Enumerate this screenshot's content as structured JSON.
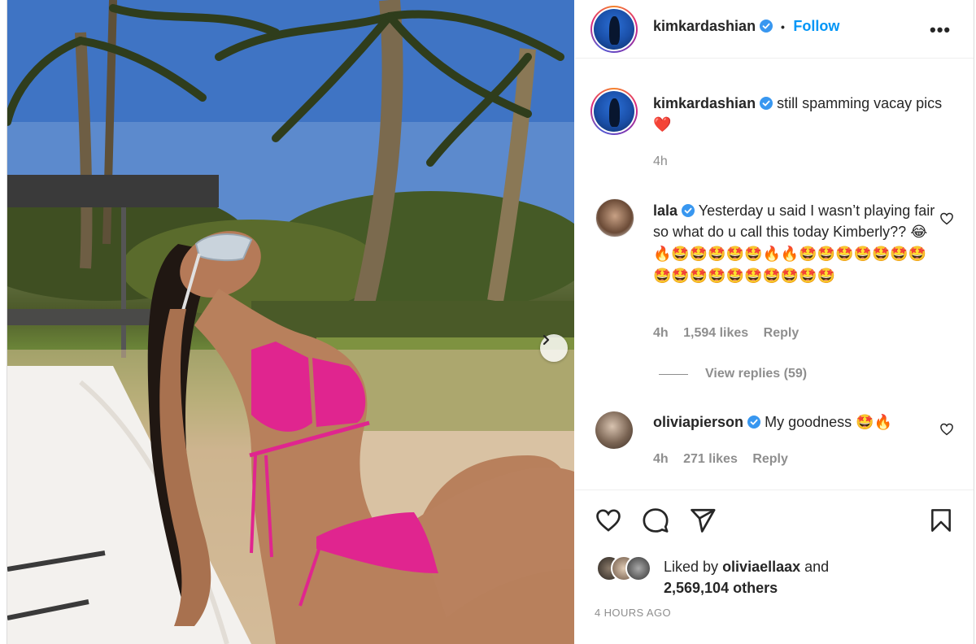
{
  "post": {
    "author": "kimkardashian",
    "follow_label": "Follow",
    "separator": "•",
    "more_label": "•••",
    "caption": "still spamming vacay pics",
    "caption_emoji": "❤️",
    "caption_time": "4h"
  },
  "comments": [
    {
      "user": "lala",
      "text": "Yesterday u said I wasn’t playing fair so what do u call this today Kimberly??",
      "emoji": "😂🔥🤩🤩🤩🤩🤩🔥🔥🤩🤩🤩🤩🤩🤩🤩🤩🤩🤩🤩🤩🤩🤩🤩🤩🤩",
      "time": "4h",
      "likes": "1,594 likes",
      "reply": "Reply",
      "view_replies": "View replies (59)"
    },
    {
      "user": "oliviapierson",
      "text": "My goodness",
      "emoji": "🤩🔥",
      "time": "4h",
      "likes": "271 likes",
      "reply": "Reply"
    }
  ],
  "likes": {
    "prefix": "Liked by",
    "user": "oliviaellaax",
    "conjunction": "and",
    "count": "2,569,104 others"
  },
  "timestamp": "4 HOURS AGO",
  "colors": {
    "accent": "#0095f6",
    "verified": "#3897f0",
    "muted": "#8e8e8e",
    "text": "#262626",
    "bikini": "#e0258f"
  },
  "icons": [
    "chevron-right-icon",
    "heart-icon",
    "comment-icon",
    "share-icon",
    "bookmark-icon",
    "verified-badge-icon",
    "more-icon"
  ]
}
